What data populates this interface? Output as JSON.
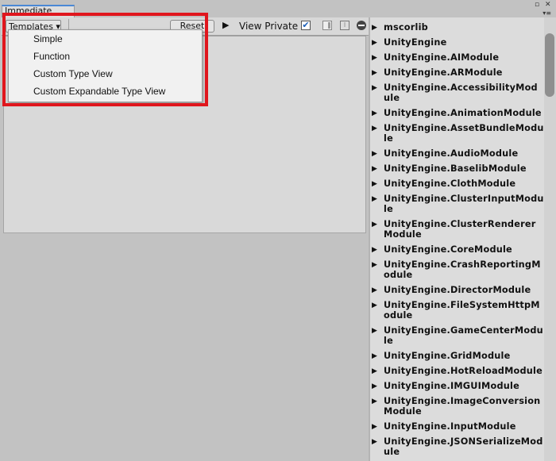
{
  "window": {
    "tab_title": "Immediate",
    "restore_glyph": "▫",
    "close_glyph": "✕",
    "tabmenu_glyph": "▾≡"
  },
  "toolbar": {
    "templates_label": "Templates ▾",
    "reset_label": "Reset",
    "play_glyph": "▶",
    "view_private_label": "View Private",
    "view_private_checked": true,
    "check_glyph": "✔",
    "options_glyph": "⁝"
  },
  "templates_menu": {
    "items": [
      {
        "label": "Simple"
      },
      {
        "label": "Function"
      },
      {
        "label": "Custom Type View"
      },
      {
        "label": "Custom Expandable Type View"
      }
    ]
  },
  "assemblies": {
    "arrow_glyph": "▶",
    "items": [
      {
        "label": "mscorlib"
      },
      {
        "label": "UnityEngine"
      },
      {
        "label": "UnityEngine.AIModule"
      },
      {
        "label": "UnityEngine.ARModule"
      },
      {
        "label": "UnityEngine.AccessibilityModule"
      },
      {
        "label": "UnityEngine.AnimationModule"
      },
      {
        "label": "UnityEngine.AssetBundleModule"
      },
      {
        "label": "UnityEngine.AudioModule"
      },
      {
        "label": "UnityEngine.BaselibModule"
      },
      {
        "label": "UnityEngine.ClothModule"
      },
      {
        "label": "UnityEngine.ClusterInputModule"
      },
      {
        "label": "UnityEngine.ClusterRendererModule"
      },
      {
        "label": "UnityEngine.CoreModule"
      },
      {
        "label": "UnityEngine.CrashReportingModule"
      },
      {
        "label": "UnityEngine.DirectorModule"
      },
      {
        "label": "UnityEngine.FileSystemHttpModule"
      },
      {
        "label": "UnityEngine.GameCenterModule"
      },
      {
        "label": "UnityEngine.GridModule"
      },
      {
        "label": "UnityEngine.HotReloadModule"
      },
      {
        "label": "UnityEngine.IMGUIModule"
      },
      {
        "label": "UnityEngine.ImageConversionModule"
      },
      {
        "label": "UnityEngine.InputModule"
      },
      {
        "label": "UnityEngine.JSONSerializeModule"
      }
    ]
  },
  "colors": {
    "highlight": "#e0161d",
    "tab_accent": "#4a88d6"
  }
}
